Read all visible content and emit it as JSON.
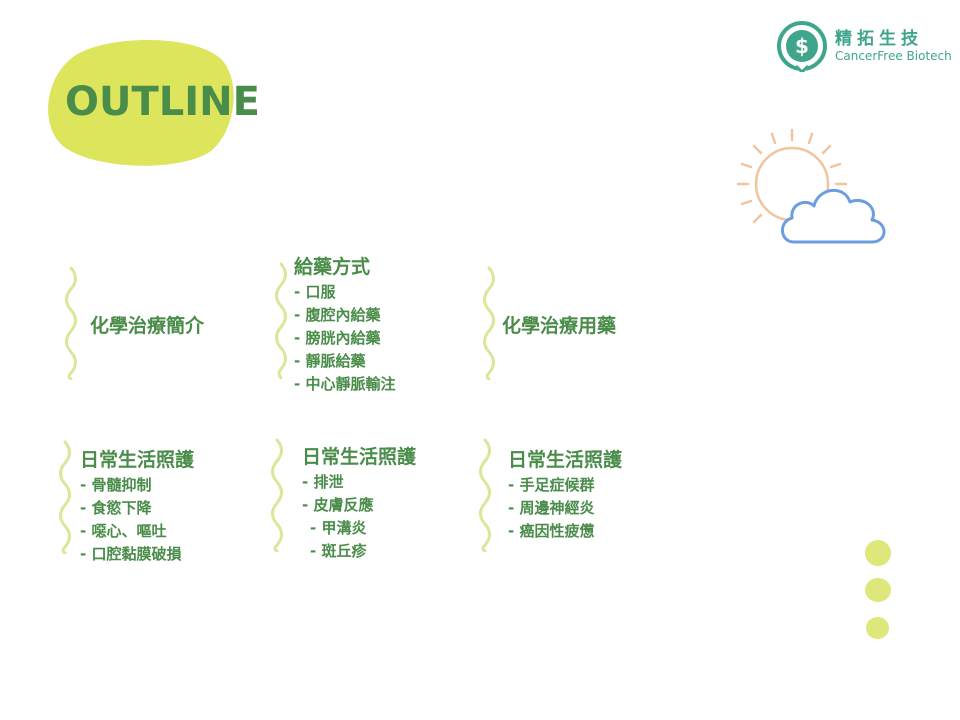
{
  "title": "OUTLINE",
  "logo": {
    "name_cn": "精拓生技",
    "name_en": "CancerFree Biotech"
  },
  "colors": {
    "accent_green": "#4a8c4a",
    "blob_yellow": "#dde55c",
    "wave_green": "#d6e89a",
    "logo_teal": "#3fa58c",
    "sun_orange": "#f1c4a0",
    "cloud_blue": "#6b9de0"
  },
  "sections": [
    {
      "heading": "化學治療簡介",
      "items": []
    },
    {
      "heading": "給藥方式",
      "items": [
        "- 口服",
        "- 腹腔內給藥",
        "- 膀胱內給藥",
        "- 靜脈給藥",
        "- 中心靜脈輸注"
      ]
    },
    {
      "heading": "化學治療用藥",
      "items": []
    },
    {
      "heading": "日常生活照護",
      "items": [
        "- 骨髓抑制",
        "- 食慾下降",
        "- 噁心、嘔吐",
        "- 口腔黏膜破損"
      ]
    },
    {
      "heading": "日常生活照護",
      "items": [
        "- 排泄",
        "- 皮膚反應",
        "- 甲溝炎",
        "- 斑丘疹"
      ]
    },
    {
      "heading": "日常生活照護",
      "items": [
        "- 手足症候群",
        "- 周邊神經炎",
        "- 癌因性疲憊"
      ]
    }
  ],
  "icons": [
    "logo-icon",
    "sun-icon",
    "cloud-icon",
    "wavy-bracket",
    "decorative-dot"
  ]
}
